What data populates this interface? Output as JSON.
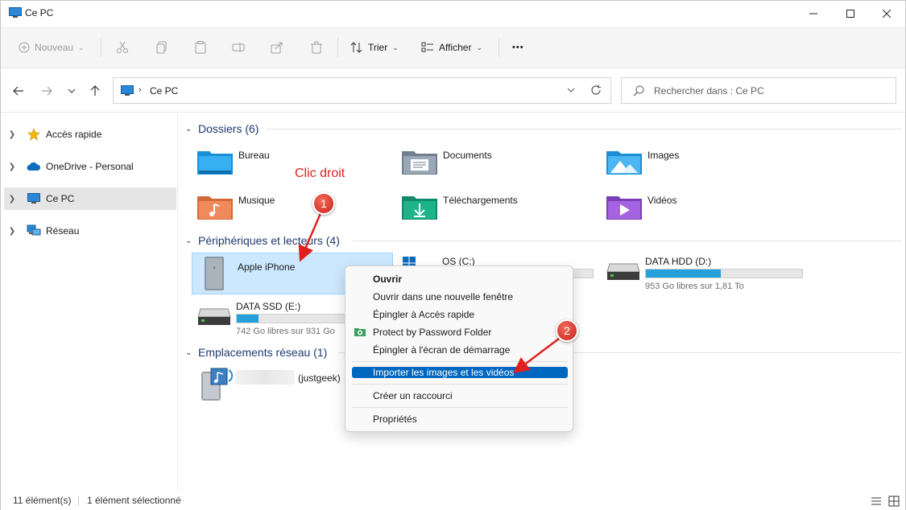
{
  "window": {
    "title": "Ce PC",
    "controls": {
      "minimize": "minimize-icon",
      "maximize": "maximize-icon",
      "close": "close-icon"
    }
  },
  "toolbar": {
    "new_label": "Nouveau",
    "sort_label": "Trier",
    "view_label": "Afficher",
    "more_label": "•••",
    "icons": [
      "new-icon",
      "cut-icon",
      "copy-icon",
      "paste-icon",
      "rename-icon",
      "share-icon",
      "delete-icon",
      "sort-icon",
      "view-icon",
      "more-icon"
    ]
  },
  "address": {
    "breadcrumb": "Ce PC",
    "search_placeholder": "Rechercher dans : Ce PC"
  },
  "sidebar": {
    "items": [
      {
        "label": "Accès rapide",
        "icon": "star-icon"
      },
      {
        "label": "OneDrive - Personal",
        "icon": "cloud-icon"
      },
      {
        "label": "Ce PC",
        "icon": "computer-icon",
        "selected": true
      },
      {
        "label": "Réseau",
        "icon": "network-icon"
      }
    ]
  },
  "main": {
    "folders_header": "Dossiers (6)",
    "folders": [
      {
        "name": "Bureau",
        "icon": "desktop-folder-icon"
      },
      {
        "name": "Documents",
        "icon": "documents-folder-icon"
      },
      {
        "name": "Images",
        "icon": "pictures-folder-icon"
      },
      {
        "name": "Musique",
        "icon": "music-folder-icon"
      },
      {
        "name": "Téléchargements",
        "icon": "downloads-folder-icon"
      },
      {
        "name": "Vidéos",
        "icon": "videos-folder-icon"
      }
    ],
    "devices_header": "Périphériques et lecteurs (4)",
    "devices": [
      {
        "name": "Apple iPhone",
        "icon": "iphone-device-icon"
      },
      {
        "name": "OS (C:)",
        "icon": "windows-drive-icon"
      },
      {
        "name": "DATA HDD (D:)",
        "free": "953 Go libres sur 1,81 To",
        "used_fraction": 0.48
      },
      {
        "name": "DATA SSD (E:)",
        "free": "742 Go libres sur 931 Go",
        "used_fraction": 0.2
      }
    ],
    "network_header": "Emplacements réseau (1)",
    "network": [
      {
        "name": "(justgeek)",
        "icon": "media-server-icon"
      }
    ]
  },
  "context_menu": {
    "items": [
      {
        "label": "Ouvrir",
        "bold": true
      },
      {
        "label": "Ouvrir dans une nouvelle fenêtre"
      },
      {
        "label": "Épingler à Accès rapide"
      },
      {
        "label": "Protect by Password Folder",
        "icon": "lock-folder-icon"
      },
      {
        "label": "Épingler à l'écran de démarrage"
      },
      {
        "label": "Importer les images et les vidéos",
        "highlighted": true
      },
      {
        "label": "Créer un raccourci"
      },
      {
        "label": "Propriétés"
      }
    ]
  },
  "annotations": {
    "callout_text": "Clic droit",
    "badge1": "1",
    "badge2": "2",
    "color": "#e02020"
  },
  "status": {
    "count": "11 élément(s)",
    "selection": "1 élément sélectionné"
  },
  "colors": {
    "accent": "#0067c0",
    "selection": "#cce8ff",
    "drive_fill": "#26a0da"
  }
}
